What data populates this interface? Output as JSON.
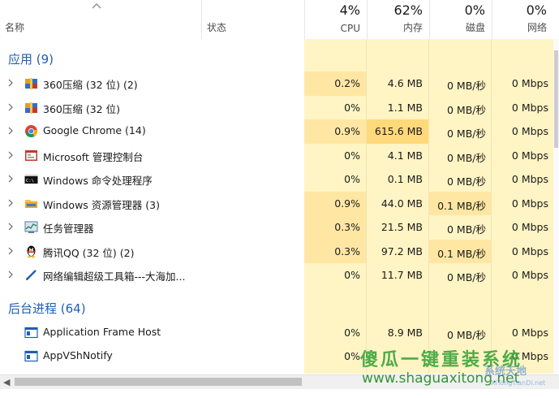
{
  "header": {
    "name_label": "名称",
    "status_label": "状态",
    "cpu": {
      "pct": "4%",
      "label": "CPU"
    },
    "mem": {
      "pct": "62%",
      "label": "内存"
    },
    "disk": {
      "pct": "0%",
      "label": "磁盘"
    },
    "net": {
      "pct": "0%",
      "label": "网络"
    }
  },
  "groups": {
    "apps": "应用 (9)",
    "background": "后台进程 (64)"
  },
  "apps": [
    {
      "name": "360压缩 (32 位) (2)",
      "icon": "archive-icon",
      "cpu": "0.2%",
      "mem": "4.6 MB",
      "disk": "0 MB/秒",
      "net": "0 Mbps"
    },
    {
      "name": "360压缩 (32 位)",
      "icon": "archive-icon",
      "cpu": "0%",
      "mem": "1.1 MB",
      "disk": "0 MB/秒",
      "net": "0 Mbps"
    },
    {
      "name": "Google Chrome (14)",
      "icon": "chrome-icon",
      "cpu": "0.9%",
      "mem": "615.6 MB",
      "disk": "0 MB/秒",
      "net": "0 Mbps"
    },
    {
      "name": "Microsoft 管理控制台",
      "icon": "mmc-icon",
      "cpu": "0%",
      "mem": "4.1 MB",
      "disk": "0 MB/秒",
      "net": "0 Mbps"
    },
    {
      "name": "Windows 命令处理程序",
      "icon": "cmd-icon",
      "cpu": "0%",
      "mem": "0.1 MB",
      "disk": "0 MB/秒",
      "net": "0 Mbps"
    },
    {
      "name": "Windows 资源管理器 (3)",
      "icon": "folder-icon",
      "cpu": "0.9%",
      "mem": "44.0 MB",
      "disk": "0.1 MB/秒",
      "net": "0 Mbps"
    },
    {
      "name": "任务管理器",
      "icon": "task-manager-icon",
      "cpu": "0.3%",
      "mem": "21.5 MB",
      "disk": "0 MB/秒",
      "net": "0 Mbps"
    },
    {
      "name": "腾讯QQ (32 位) (2)",
      "icon": "qq-penguin-icon",
      "cpu": "0.3%",
      "mem": "97.2 MB",
      "disk": "0.1 MB/秒",
      "net": "0 Mbps"
    },
    {
      "name": "网络编辑超级工具箱---大海加...",
      "icon": "pen-tool-icon",
      "cpu": "0%",
      "mem": "11.7 MB",
      "disk": "0 MB/秒",
      "net": "0 Mbps"
    }
  ],
  "background": [
    {
      "name": "Application Frame Host",
      "icon": "app-window-icon",
      "cpu": "0%",
      "mem": "8.9 MB",
      "disk": "0 MB/秒",
      "net": "0 Mbps"
    },
    {
      "name": "AppVShNotify",
      "icon": "app-window-icon",
      "cpu": "0%",
      "mem": "",
      "disk": "",
      "net": "0 Mbps"
    }
  ],
  "watermark": {
    "line1": "傻瓜一键重装系统",
    "line2": "www.shaguaxitong.net",
    "logo_text": "系统天地",
    "logo_sub": "XiTongTianDi.net"
  },
  "colors": {
    "accent": "#1f5fb5",
    "heat_low": "#fff4c4",
    "heat_mid": "#ffe7a3",
    "heat_high": "#ffd97a"
  }
}
